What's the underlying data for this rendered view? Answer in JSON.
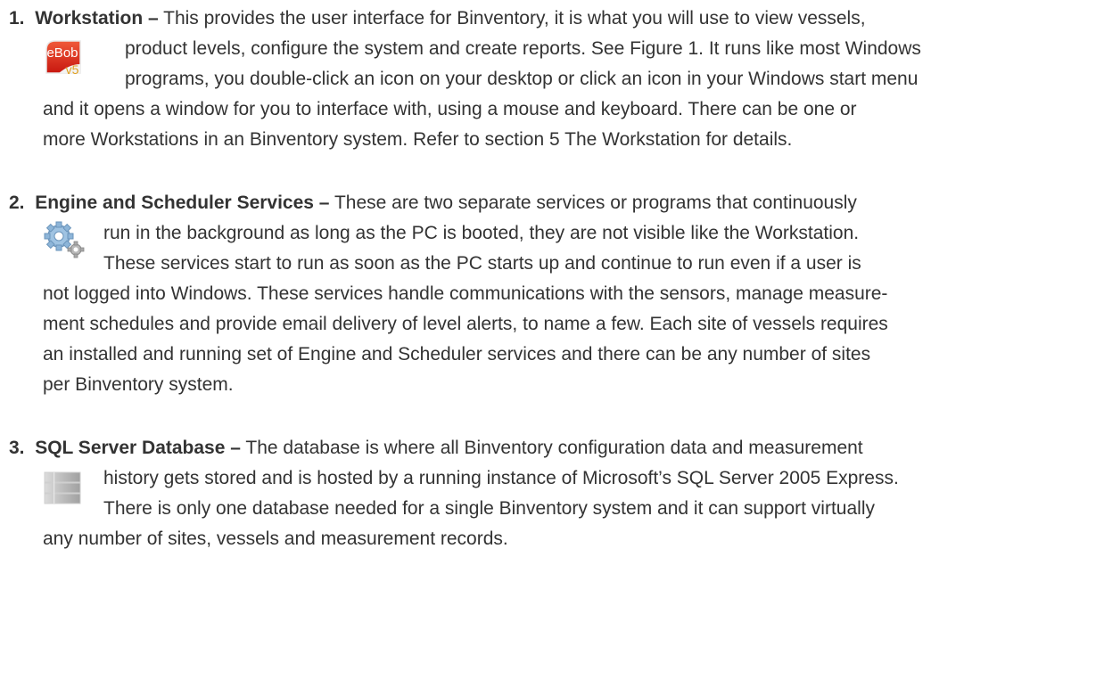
{
  "items": [
    {
      "number": "1.",
      "term": "Workstation –",
      "icon": "ebob-v5-icon",
      "lines": [
        " This provides the user interface for Binventory, it is what you will use to view vessels,",
        "product levels, configure the system and create reports. See Figure 1. It runs like most Windows",
        "programs, you double-click an icon on your desktop or click an icon in your Windows start menu",
        "and it opens a window for you to interface with, using a mouse and keyboard. There can be one or",
        "more Workstations in an Binventory system. Refer to section 5 The Workstation for details."
      ],
      "icon_text": {
        "top": "eBob",
        "bottom": "v5"
      }
    },
    {
      "number": "2.",
      "term": "Engine and Scheduler Services –",
      "icon": "gears-icon",
      "lines": [
        " These are two separate services or programs that continuously",
        "run in the background as long as the PC is booted, they are not visible like the Workstation.",
        "These services start to run as soon as the PC starts up and continue to run even if a user is",
        "not logged into Windows. These services handle communications with the sensors, manage measure-",
        "ment schedules and provide email delivery of level alerts, to name a few. Each site of vessels requires",
        "an installed and running set of Engine and Scheduler services and there can be any number of sites",
        "per Binventory system."
      ]
    },
    {
      "number": "3.",
      "term": "SQL Server Database –",
      "icon": "database-icon",
      "lines": [
        " The database is where all Binventory configuration data and measurement",
        "history gets stored and is hosted by a running instance of Microsoft’s SQL Server 2005 Express.",
        "There is only one database needed for a single Binventory system and it can support virtually",
        "any number of sites, vessels and measurement records."
      ]
    }
  ],
  "colors": {
    "text": "#333333",
    "ebob_red": "#d9261c",
    "gear_blue": "#5a8fc0",
    "db_grey": "#b8b8b8"
  }
}
